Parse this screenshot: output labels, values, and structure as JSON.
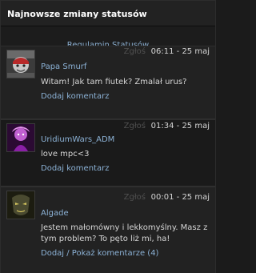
{
  "widget": {
    "title": "Najnowsze zmiany statusów"
  },
  "rules_link": "Regulamin Statusów",
  "statuses": [
    {
      "report_label": "Zgłoś",
      "time": "06:11 - 25 maj",
      "author": "Papa Smurf",
      "message": "Witam! Jak tam fiutek? Zmalał urus?",
      "action": "Dodaj komentarz",
      "avatar_icon": "avatar-icon"
    },
    {
      "report_label": "Zgłoś",
      "time": "01:34 - 25 maj",
      "author": "UridiumWars_ADM",
      "message": "love mpc<3",
      "action": "Dodaj komentarz",
      "avatar_icon": "avatar-icon"
    },
    {
      "report_label": "Zgłoś",
      "time": "00:01 - 25 maj",
      "author": "Algade",
      "message": "Jestem małomówny i lekkomyślny. Masz z tym problem? To pęto liż mi, ha!",
      "action": "Dodaj / Pokaż komentarze (4)",
      "avatar_icon": "avatar-icon"
    }
  ]
}
